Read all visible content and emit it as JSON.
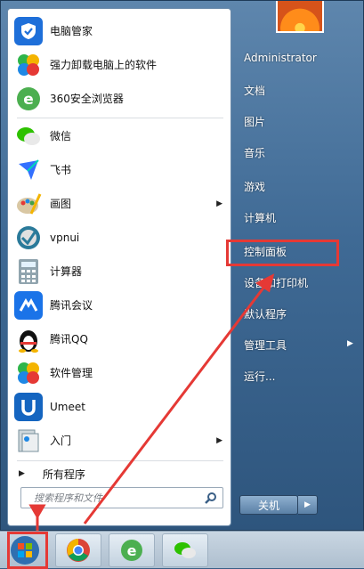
{
  "left_panel": {
    "items": [
      {
        "label": "电脑管家",
        "icon": "shield-icon"
      },
      {
        "label": "强力卸载电脑上的软件",
        "icon": "pinwheel-icon"
      },
      {
        "label": "360安全浏览器",
        "icon": "browser-e-icon"
      },
      {
        "label": "微信",
        "icon": "wechat-icon"
      },
      {
        "label": "飞书",
        "icon": "paper-plane-icon"
      },
      {
        "label": "画图",
        "icon": "paint-palette-icon"
      },
      {
        "label": "vpnui",
        "icon": "vpn-icon"
      },
      {
        "label": "计算器",
        "icon": "calculator-icon"
      },
      {
        "label": "腾讯会议",
        "icon": "meeting-icon"
      },
      {
        "label": "腾讯QQ",
        "icon": "penguin-icon"
      },
      {
        "label": "软件管理",
        "icon": "pinwheel-icon"
      },
      {
        "label": "Umeet",
        "icon": "umeet-icon"
      },
      {
        "label": "入门",
        "icon": "getting-started-icon"
      }
    ],
    "all_programs": "所有程序",
    "search_placeholder": "搜索程序和文件"
  },
  "right_panel": {
    "items": [
      "Administrator",
      "文档",
      "图片",
      "音乐",
      "游戏",
      "计算机",
      "控制面板",
      "设备和打印机",
      "默认程序",
      "管理工具",
      "运行..."
    ],
    "shutdown": "关机"
  },
  "colors": {
    "highlight": "#e53935"
  }
}
